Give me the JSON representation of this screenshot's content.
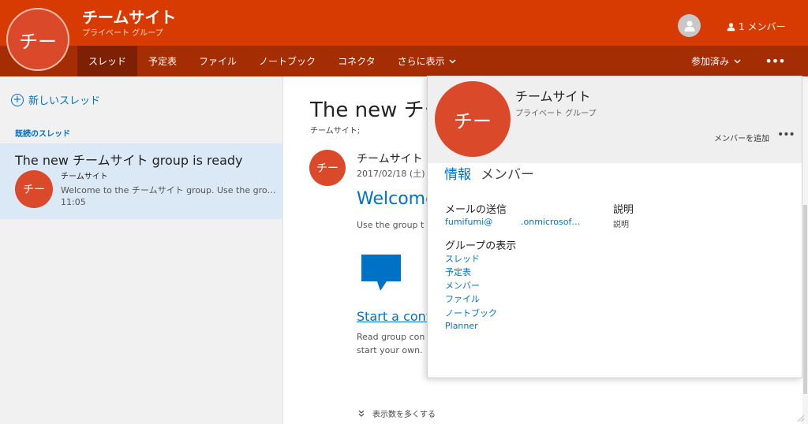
{
  "header": {
    "avatar_text": "チー",
    "title": "チームサイト",
    "subtitle": "プライベート グループ",
    "members_label": "1 メンバー",
    "joined_label": "参加済み",
    "nav": [
      "スレッド",
      "予定表",
      "ファイル",
      "ノートブック",
      "コネクタ",
      "さらに表示"
    ]
  },
  "left": {
    "new_thread": "新しいスレッド",
    "section_label": "既読のスレッド",
    "thread": {
      "title": "The new チームサイト group is ready",
      "avatar_text": "チー",
      "sender": "チームサイト",
      "preview": "Welcome to the チームサイト group. Use the group to share ideas, files, and important dates.",
      "time": "11:05"
    }
  },
  "main": {
    "title": "The new チー",
    "meta": "チームサイト;",
    "avatar_text": "チー",
    "sender": "チームサイト",
    "date": "2017/02/18 (土)",
    "welcome": "Welcome",
    "use_group": "Use the group t",
    "start_conv": "Start a conv",
    "read_line1": "Read group con",
    "read_line2": "start your own.",
    "show_more": "表示数を多くする"
  },
  "panel": {
    "avatar_text": "チー",
    "title": "チームサイト",
    "subtitle": "プライベート グループ",
    "add_member": "メンバーを追加",
    "tabs": [
      "情報",
      "メンバー"
    ],
    "mail_label": "メールの送信",
    "mail_value_user": "fumifumi@",
    "mail_value_domain": ".onmicrosof…",
    "desc_label": "説明",
    "desc_value": "説明",
    "view_label": "グループの表示",
    "view_links": [
      "スレッド",
      "予定表",
      "メンバー",
      "ファイル",
      "ノートブック",
      "Planner"
    ]
  },
  "colors": {
    "brand": "#d83b01",
    "nav_bar": "#a52d04",
    "link": "#0072c6",
    "avatar": "#d9492a"
  }
}
